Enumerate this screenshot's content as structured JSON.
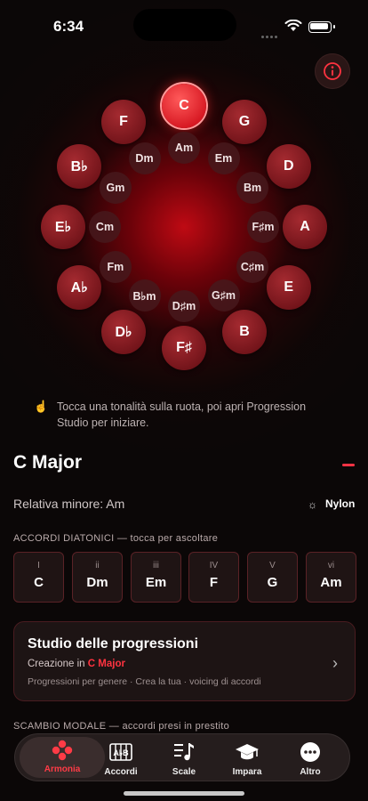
{
  "status_bar": {
    "time": "6:34"
  },
  "wheel": {
    "major_keys": [
      {
        "name": "C",
        "selected": true
      },
      {
        "name": "G",
        "selected": false
      },
      {
        "name": "D",
        "selected": false
      },
      {
        "name": "A",
        "selected": false
      },
      {
        "name": "E",
        "selected": false
      },
      {
        "name": "B",
        "selected": false
      },
      {
        "name": "F♯",
        "selected": false
      },
      {
        "name": "D♭",
        "selected": false
      },
      {
        "name": "A♭",
        "selected": false
      },
      {
        "name": "E♭",
        "selected": false
      },
      {
        "name": "B♭",
        "selected": false
      },
      {
        "name": "F",
        "selected": false
      }
    ],
    "minor_keys": [
      "Am",
      "Em",
      "Bm",
      "F♯m",
      "C♯m",
      "G♯m",
      "D♯m",
      "B♭m",
      "Fm",
      "Cm",
      "Gm",
      "Dm"
    ]
  },
  "hint": "Tocca una tonalità sulla ruota, poi apri Progression Studio per iniziare.",
  "key_info": {
    "title": "C Major",
    "relative": "Relativa minore: Am",
    "instrument": "Nylon"
  },
  "diatonic": {
    "label": "ACCORDI DIATONICI — tocca per ascoltare",
    "chords": [
      {
        "degree": "I",
        "name": "C"
      },
      {
        "degree": "ii",
        "name": "Dm"
      },
      {
        "degree": "iii",
        "name": "Em"
      },
      {
        "degree": "IV",
        "name": "F"
      },
      {
        "degree": "V",
        "name": "G"
      },
      {
        "degree": "vi",
        "name": "Am"
      }
    ]
  },
  "studio": {
    "title": "Studio delle progressioni",
    "subtitle_prefix": "Creazione in",
    "subtitle_key": "C Major",
    "description": "Progressioni per genere · Crea la tua · voicing di accordi"
  },
  "modal_label": "SCAMBIO MODALE — accordi presi in prestito",
  "tabs": [
    {
      "label": "Armonia",
      "icon": "harmony-icon"
    },
    {
      "label": "Accordi",
      "icon": "chords-icon"
    },
    {
      "label": "Scale",
      "icon": "scale-icon"
    },
    {
      "label": "Impara",
      "icon": "learn-icon"
    },
    {
      "label": "Altro",
      "icon": "more-icon"
    }
  ],
  "colors": {
    "accent": "#ff3340",
    "key_bubble": "#8a1a20",
    "selected_key": "#e01822",
    "background": "#0b0707"
  }
}
